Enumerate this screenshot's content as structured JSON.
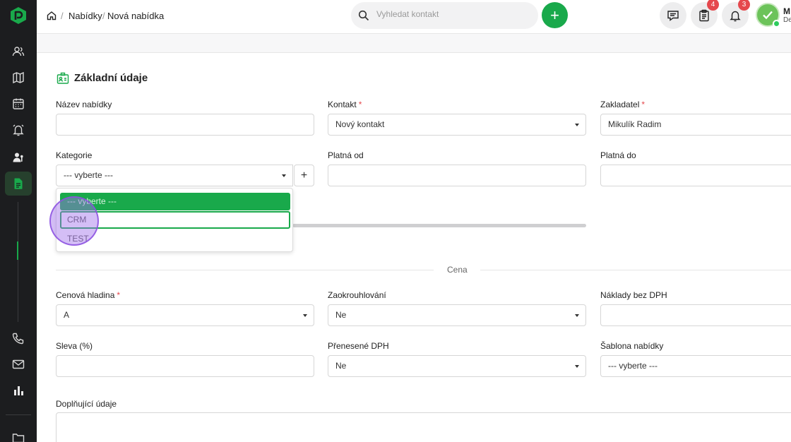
{
  "breadcrumb": {
    "items": [
      "Nabídky",
      "Nová nabídka"
    ]
  },
  "search": {
    "placeholder": "Vyhledat kontakt"
  },
  "header": {
    "add_label": "+",
    "notes_badge": "4",
    "bell_badge": "3",
    "user_initial": "M",
    "user_sub": "De"
  },
  "section": {
    "title": "Základní údaje"
  },
  "fields": {
    "nazev": {
      "label": "Název nabídky",
      "value": ""
    },
    "kontakt": {
      "label": "Kontakt",
      "required": "*",
      "value": "Nový kontakt"
    },
    "zakladatel": {
      "label": "Zakladatel",
      "required": "*",
      "value": "Mikulík Radim"
    },
    "kategorie": {
      "label": "Kategorie",
      "value": "--- vyberte ---",
      "add_label": "+"
    },
    "platna_od": {
      "label": "Platná od",
      "value": ""
    },
    "platna_do": {
      "label": "Platná do",
      "value": ""
    },
    "cenova_hladina": {
      "label": "Cenová hladina",
      "required": "*",
      "value": "A"
    },
    "zaokrouhlovani": {
      "label": "Zaokrouhlování",
      "value": "Ne"
    },
    "naklady": {
      "label": "Náklady bez DPH",
      "value": ""
    },
    "sleva": {
      "label": "Sleva (%)",
      "value": ""
    },
    "prenesene_dph": {
      "label": "Přenesené DPH",
      "value": "Ne"
    },
    "sablona": {
      "label": "Šablona nabídky",
      "value": "--- vyberte ---"
    },
    "doplnujici": {
      "label": "Doplňující údaje",
      "value": ""
    }
  },
  "dropdown": {
    "options": [
      "--- vyberte ---",
      "CRM",
      "TEST"
    ],
    "selected": "--- vyberte ---",
    "focused": "CRM"
  },
  "divider": {
    "label": "Cena"
  },
  "colors": {
    "accent": "#19a94b",
    "sidebar": "#1c1d1f",
    "badge": "#e5484d",
    "required": "#e5484d"
  }
}
